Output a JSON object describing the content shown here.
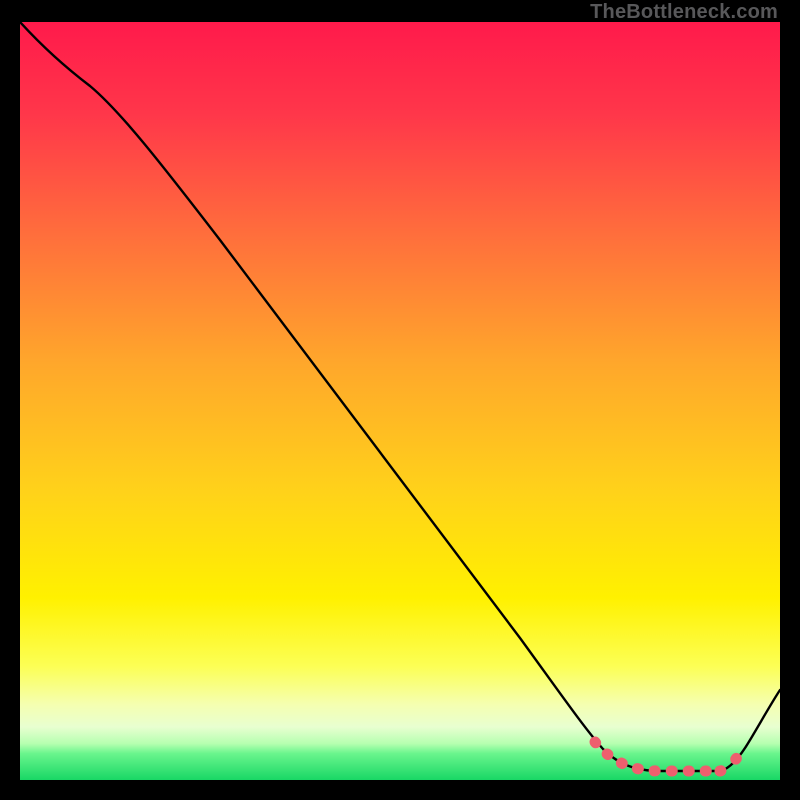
{
  "attribution": "TheBottleneck.com",
  "chart_data": {
    "type": "line",
    "title": "",
    "xlabel": "",
    "ylabel": "",
    "xlim": [
      0,
      100
    ],
    "ylim": [
      0,
      100
    ],
    "x": [
      0,
      5,
      10,
      20,
      30,
      40,
      50,
      60,
      70,
      75,
      80,
      85,
      88,
      92,
      100
    ],
    "values": [
      100,
      95,
      92,
      80,
      68,
      55,
      43,
      31,
      18,
      11,
      4,
      1,
      0,
      1,
      12
    ],
    "highlight_range_x": [
      75,
      92
    ],
    "legend": "",
    "grid": false
  },
  "colors": {
    "background_top": "#ff1a4b",
    "background_mid": "#ffd600",
    "background_yellow_band": "#fbff8f",
    "background_bottom": "#1ee66e",
    "line": "#000000",
    "highlight_dot": "#ee5f6e"
  }
}
